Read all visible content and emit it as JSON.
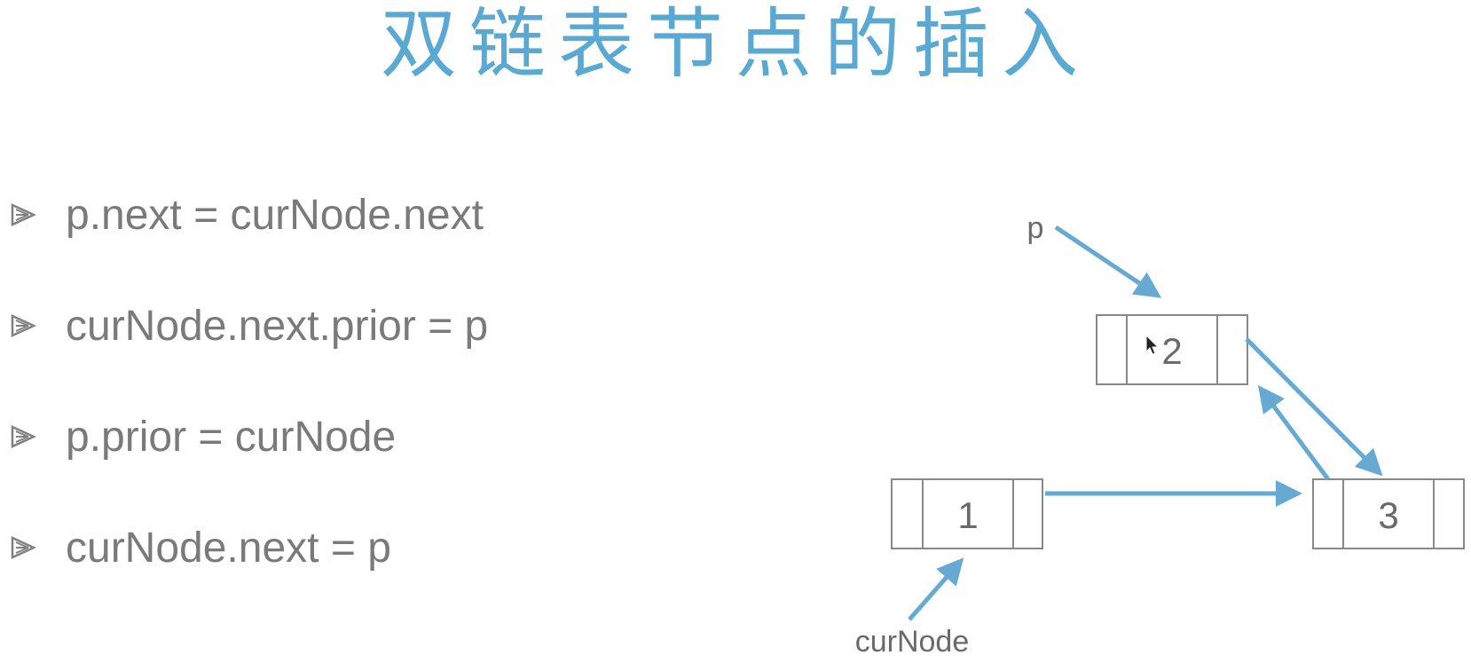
{
  "title": "双链表节点的插入",
  "steps": [
    "p.next = curNode.next",
    "curNode.next.prior = p",
    "p.prior = curNode",
    "curNode.next = p"
  ],
  "diagram": {
    "nodes": [
      "1",
      "2",
      "3"
    ],
    "pointer_labels": {
      "p": "p",
      "cur": "curNode"
    }
  },
  "colors": {
    "title": "#5aa9d3",
    "arrow": "#66aad4",
    "text": "#7a7a7a"
  },
  "icons": {
    "bullet": "triangle-bullet-icon",
    "cursor": "mouse-cursor-icon"
  }
}
